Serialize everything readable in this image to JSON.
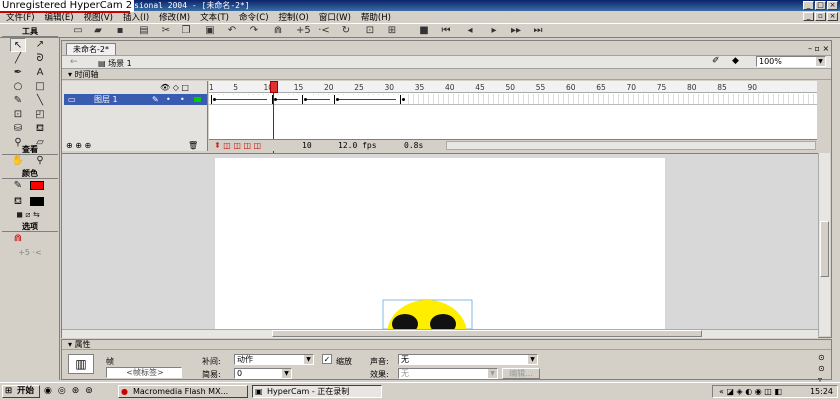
{
  "watermark": "Unregistered HyperCam 2",
  "window": {
    "title": "rofessional 2004 - [未命名-2*]"
  },
  "menu": [
    "文件(F)",
    "编辑(E)",
    "视图(V)",
    "插入(I)",
    "修改(M)",
    "文本(T)",
    "命令(C)",
    "控制(O)",
    "窗口(W)",
    "帮助(H)"
  ],
  "tools": {
    "header": "工具",
    "view_header": "查看",
    "color_header": "颜色",
    "options_header": "选项"
  },
  "document": {
    "tab": "未命名-2*",
    "scene": "场景 1",
    "zoom": "100%"
  },
  "timeline": {
    "header": "时间轴",
    "layer_name": "图层 1",
    "ticks": [
      "1",
      "5",
      "10",
      "15",
      "20",
      "25",
      "30",
      "35",
      "40",
      "45",
      "50",
      "55",
      "60",
      "65",
      "70",
      "75",
      "80",
      "85",
      "90"
    ],
    "current_frame": "10",
    "fps": "12.0 fps",
    "elapsed": "0.8s"
  },
  "properties": {
    "header": "属性",
    "frame_label": "帧",
    "frame_name_placeholder": "<帧标签>",
    "tween_label": "补间:",
    "tween_value": "动作",
    "scale_label": "缩放",
    "ease_label": "简易:",
    "ease_value": "0",
    "sound_label": "声音:",
    "sound_value": "无",
    "effect_label": "效果:",
    "effect_value": "无",
    "edit_button": "编辑..."
  },
  "taskbar": {
    "start": "开始",
    "tasks": [
      "Macromedia Flash MX...",
      "HyperCam - 正在录制"
    ],
    "clock": "15:24"
  },
  "colors": {
    "stroke": "#000000",
    "fill": "#ff0000",
    "smiley": "#ffee00"
  }
}
